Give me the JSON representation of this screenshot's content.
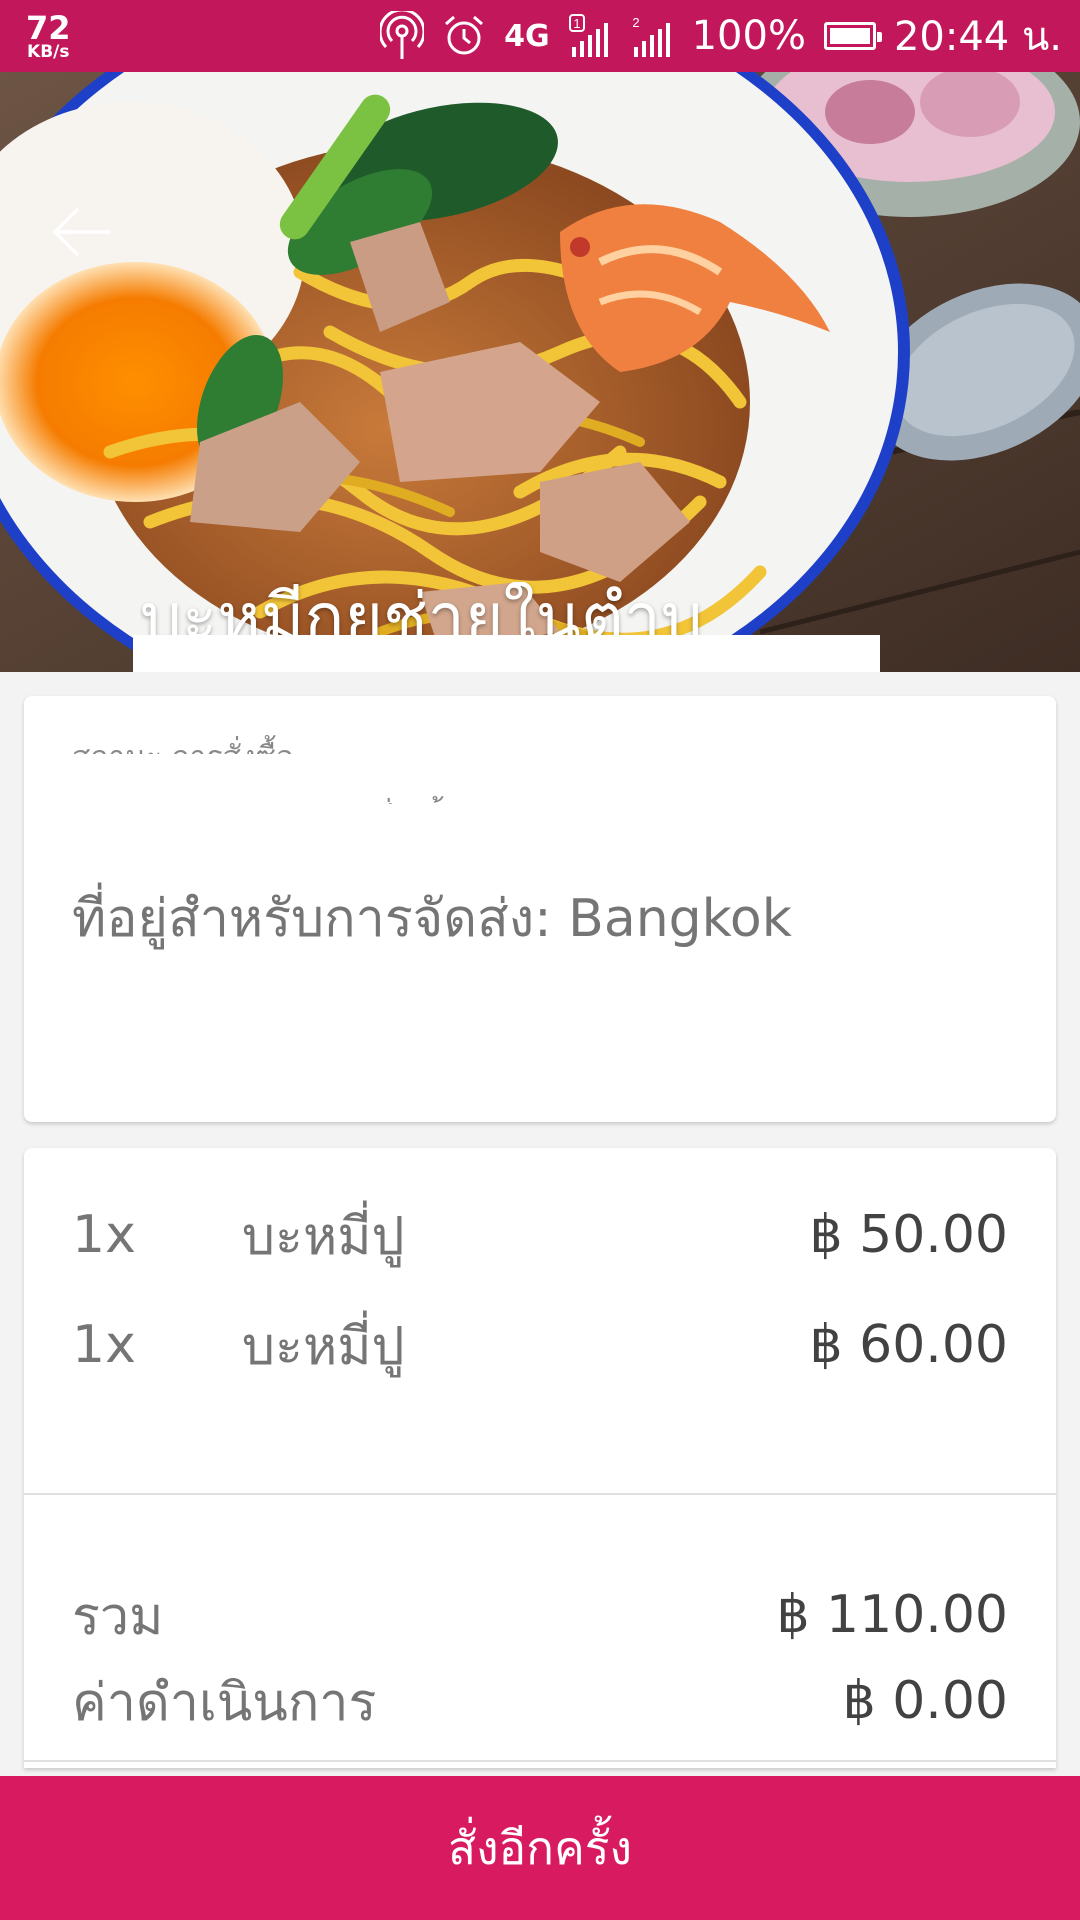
{
  "status_bar": {
    "net_speed_value": "72",
    "net_speed_unit": "KB/s",
    "network_type": "4G",
    "sim1": "1",
    "sim2": "2",
    "battery_percent": "100%",
    "battery_level": 1.0,
    "time": "20:44 น.",
    "icons": [
      "hotspot-icon",
      "alarm-icon",
      "signal-icon",
      "battery-icon"
    ]
  },
  "header": {
    "back_icon": "arrow-left-icon",
    "restaurant_title": "บะหมี่กุยช่ายในตำบ"
  },
  "info_card": {
    "faded_line_1": "สถานะ การสั่งซื้อ",
    "faded_line_2": "ส่งแล้ว",
    "delivery_address": "ที่อยู่สำหรับการจัดส่ง: Bangkok"
  },
  "order": {
    "items": [
      {
        "qty": "1x",
        "name": "บะหมี่ปู",
        "price": "฿ 50.00"
      },
      {
        "qty": "1x",
        "name": "บะหมี่ปู",
        "price": "฿ 60.00"
      }
    ],
    "subtotal_label": "รวม",
    "subtotal_value": "฿ 110.00",
    "fee_label": "ค่าดำเนินการ",
    "fee_value": "฿ 0.00"
  },
  "actions": {
    "reorder_label": "สั่งอีกครั้ง"
  },
  "colors": {
    "brand": "#c2185b",
    "button": "#d81b60"
  }
}
